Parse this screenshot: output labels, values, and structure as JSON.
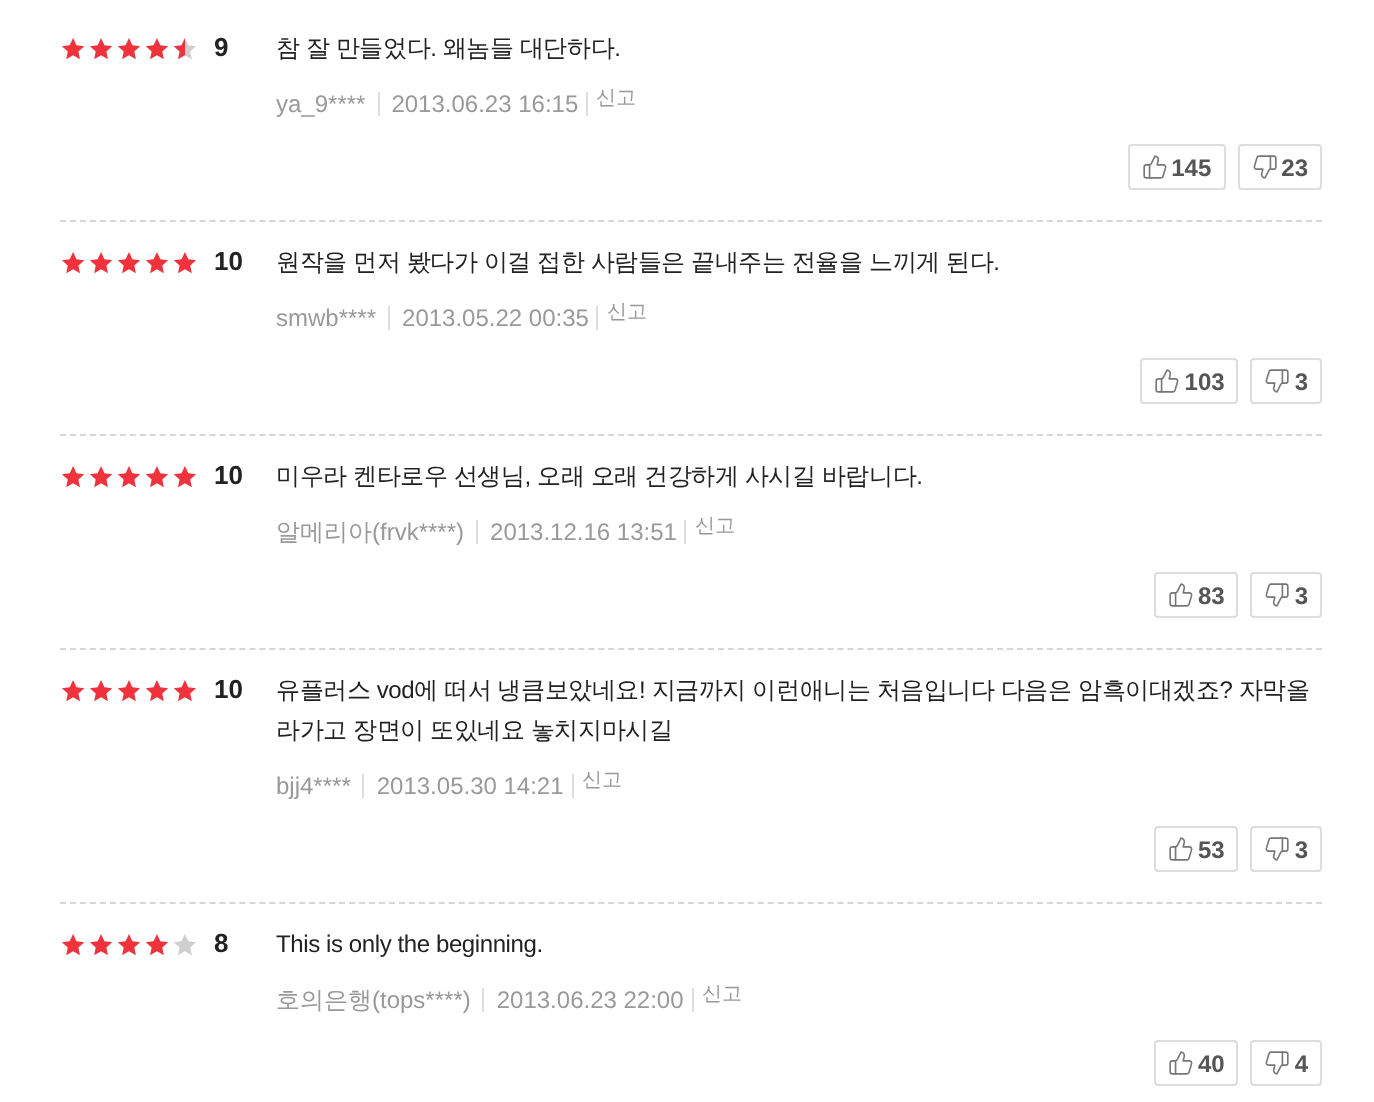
{
  "reviews": [
    {
      "stars": 4.5,
      "score": "9",
      "text": "참 잘 만들었다. 왜놈들 대단하다.",
      "author": "ya_9****",
      "date": "2013.06.23 16:15",
      "report": "신고",
      "likes": "145",
      "dislikes": "23"
    },
    {
      "stars": 5,
      "score": "10",
      "text": "원작을 먼저 봤다가 이걸 접한 사람들은 끝내주는 전율을 느끼게 된다.",
      "author": "smwb****",
      "date": "2013.05.22 00:35",
      "report": "신고",
      "likes": "103",
      "dislikes": "3"
    },
    {
      "stars": 5,
      "score": "10",
      "text": "미우라 켄타로우 선생님, 오래 오래 건강하게 사시길 바랍니다.",
      "author": "알메리아(frvk****)",
      "date": "2013.12.16 13:51",
      "report": "신고",
      "likes": "83",
      "dislikes": "3"
    },
    {
      "stars": 5,
      "score": "10",
      "text": "유플러스 vod에 떠서 냉큼보았네요! 지금까지 이런애니는 처음입니다 다음은 암흑이대겠죠? 자막올라가고 장면이 또있네요 놓치지마시길",
      "author": "bjj4****",
      "date": "2013.05.30 14:21",
      "report": "신고",
      "likes": "53",
      "dislikes": "3"
    },
    {
      "stars": 4,
      "score": "8",
      "text": "This is only the beginning.",
      "author": "호의은행(tops****)",
      "date": "2013.06.23 22:00",
      "report": "신고",
      "likes": "40",
      "dislikes": "4"
    }
  ]
}
